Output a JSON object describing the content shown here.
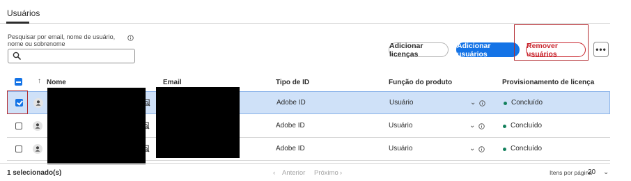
{
  "tabs": [
    {
      "label": "Usuários"
    }
  ],
  "search": {
    "label": "Pesquisar por email, nome de usuário, nome ou sobrenome",
    "value": ""
  },
  "toolbar": {
    "add_licenses": "Adicionar licenças",
    "add_users": "Adicionar usuários",
    "remove_users": "Remover usuários",
    "more": "•••"
  },
  "table": {
    "columns": {
      "name": "Nome",
      "email": "Email",
      "id_type": "Tipo de ID",
      "product_role": "Função do produto",
      "license_provisioning": "Provisionamento de licença"
    },
    "rows": [
      {
        "id_type": "Adobe ID",
        "role": "Usuário",
        "status": "Concluído",
        "selected": true
      },
      {
        "id_type": "Adobe ID",
        "role": "Usuário",
        "status": "Concluído",
        "selected": false
      },
      {
        "id_type": "Adobe ID",
        "role": "Usuário",
        "status": "Concluído",
        "selected": false
      }
    ]
  },
  "footer": {
    "selected_count": "1 selecionado(s)",
    "previous": "Anterior",
    "next": "Próximo",
    "items_per_page_label": "Itens por página",
    "items_per_page_value": "20"
  },
  "colors": {
    "accent": "#1473e6",
    "danger": "#c9252d",
    "status_ok": "#12805c",
    "selected_row": "#cfe1f8"
  }
}
